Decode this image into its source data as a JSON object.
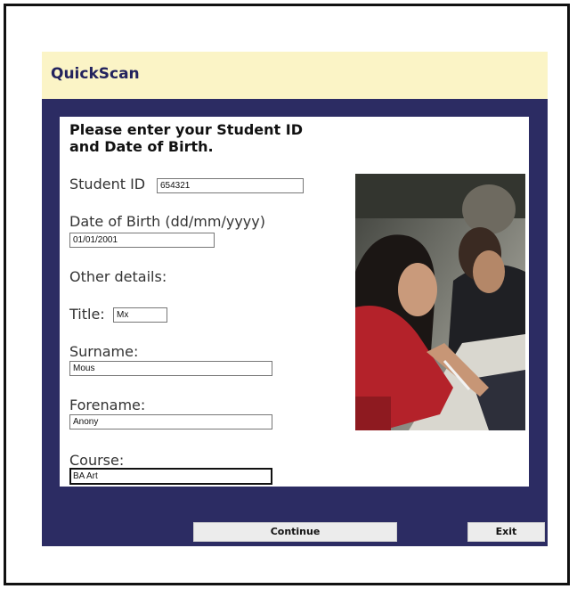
{
  "app": {
    "title": "QuickScan"
  },
  "form": {
    "prompt": "Please enter your Student ID and Date of Birth.",
    "student_id": {
      "label": "Student ID",
      "value": "654321"
    },
    "dob": {
      "label": "Date of Birth (dd/mm/yyyy)",
      "value": "01/01/2001"
    },
    "other_details_label": "Other details:",
    "title": {
      "label": "Title:",
      "value": "Mx"
    },
    "surname": {
      "label": "Surname:",
      "value": "Mous"
    },
    "forename": {
      "label": "Forename:",
      "value": "Anony"
    },
    "course": {
      "label": "Course:",
      "value": "BA Art"
    }
  },
  "buttons": {
    "continue": "Continue",
    "exit": "Exit"
  },
  "colors": {
    "header_bg": "#fbf4c6",
    "panel_bg": "#2c2c63",
    "title_color": "#23235e"
  }
}
